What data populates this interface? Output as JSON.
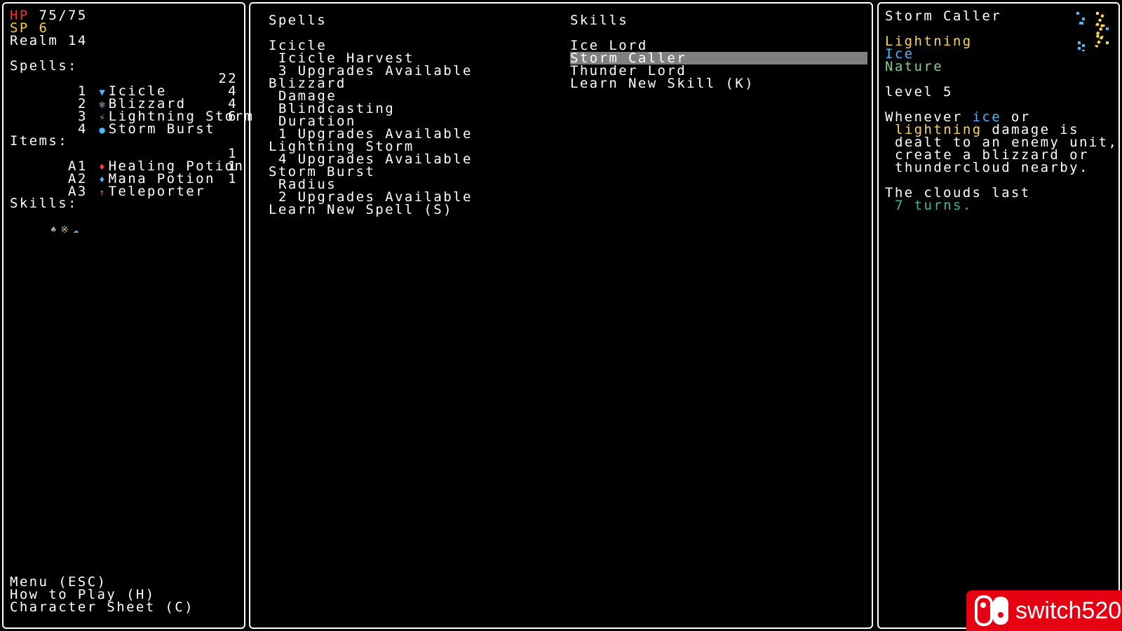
{
  "stats": {
    "hp_label": "HP",
    "hp_value": "75/75",
    "sp_label": "SP",
    "sp_value": "6",
    "realm": "Realm 14"
  },
  "spells_heading": "Spells:",
  "spells": [
    {
      "key": "1",
      "name": "Icicle",
      "count": "22",
      "icon": "icicle-icon"
    },
    {
      "key": "2",
      "name": "Blizzard",
      "count": "4",
      "icon": "blizzard-icon"
    },
    {
      "key": "3",
      "name": "Lightning Storm",
      "count": "4",
      "icon": "lightning-storm-icon"
    },
    {
      "key": "4",
      "name": "Storm Burst",
      "count": "6",
      "icon": "storm-burst-icon"
    }
  ],
  "items_heading": "Items:",
  "items": [
    {
      "key": "A1",
      "name": "Healing Potion",
      "count": "1",
      "icon": "healing-potion-icon"
    },
    {
      "key": "A2",
      "name": "Mana Potion",
      "count": "1",
      "icon": "mana-potion-icon"
    },
    {
      "key": "A3",
      "name": "Teleporter",
      "count": "1",
      "icon": "teleporter-icon"
    }
  ],
  "skills_heading": "Skills:",
  "left_menu": {
    "menu": "Menu (ESC)",
    "how_to_play": "How to Play (H)",
    "character_sheet": "Character Sheet (C)"
  },
  "middle": {
    "spells_col_title": "Spells",
    "skills_col_title": "Skills",
    "spell_tree": [
      {
        "text": "Icicle",
        "indent": 0
      },
      {
        "text": "Icicle Harvest",
        "indent": 1
      },
      {
        "text": "3 Upgrades Available",
        "indent": 1
      },
      {
        "text": "Blizzard",
        "indent": 0
      },
      {
        "text": "Damage",
        "indent": 1
      },
      {
        "text": "Blindcasting",
        "indent": 1
      },
      {
        "text": "Duration",
        "indent": 1
      },
      {
        "text": "1 Upgrades Available",
        "indent": 1
      },
      {
        "text": "Lightning Storm",
        "indent": 0
      },
      {
        "text": "4 Upgrades Available",
        "indent": 1
      },
      {
        "text": "Storm Burst",
        "indent": 0
      },
      {
        "text": "Radius",
        "indent": 1
      },
      {
        "text": "2 Upgrades Available",
        "indent": 1
      },
      {
        "text": "Learn New Spell (S)",
        "indent": 0
      }
    ],
    "skill_list": [
      {
        "text": "Ice Lord",
        "selected": false
      },
      {
        "text": "Storm Caller",
        "selected": true
      },
      {
        "text": "Thunder Lord",
        "selected": false
      },
      {
        "text": "Learn New Skill (K)",
        "selected": false
      }
    ]
  },
  "detail": {
    "title": "Storm Caller",
    "tags": [
      {
        "text": "Lightning",
        "color": "#ffd84a"
      },
      {
        "text": "Ice",
        "color": "#4db8ff"
      },
      {
        "text": "Nature",
        "color": "#7fd48a"
      }
    ],
    "level": "level 5",
    "desc_1a": "Whenever ",
    "desc_ice": "ice",
    "desc_1b": " or",
    "desc_lightning": "lightning",
    "desc_2b": " damage is",
    "desc_3": "dealt to an enemy unit,",
    "desc_4": "create a blizzard or",
    "desc_5": "thundercloud nearby.",
    "desc_6": "The clouds last",
    "desc_7": "7 turns."
  },
  "watermark": {
    "text": "switch520"
  }
}
